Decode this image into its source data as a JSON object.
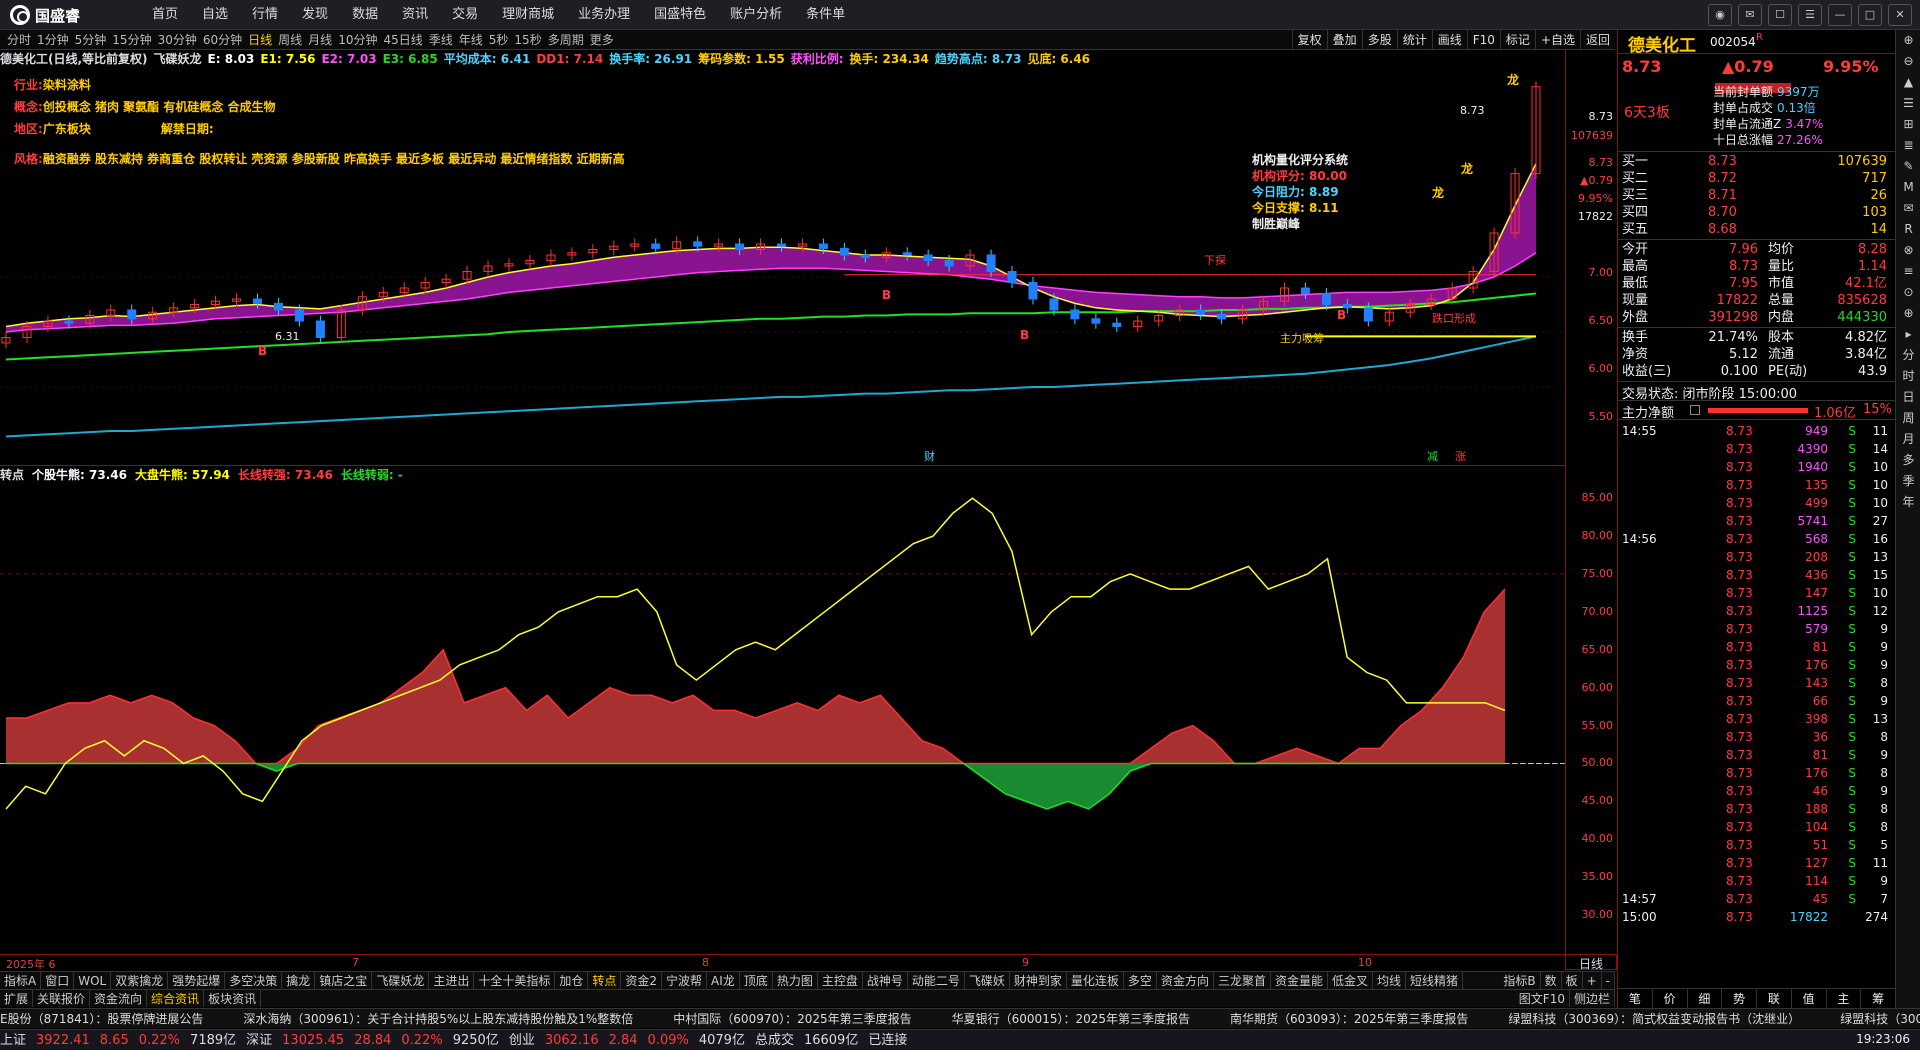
{
  "app": {
    "brand": "国盛睿",
    "menu": [
      "首页",
      "自选",
      "行情",
      "发现",
      "数据",
      "资讯",
      "交易",
      "理财商城",
      "业务办理",
      "国盛特色",
      "账户分析",
      "条件单"
    ]
  },
  "periods": [
    "分时",
    "1分钟",
    "5分钟",
    "15分钟",
    "30分钟",
    "60分钟",
    "日线",
    "周线",
    "月线",
    "10分钟",
    "45日线",
    "季线",
    "年线",
    "5秒",
    "15秒",
    "多周期",
    "更多"
  ],
  "selected_period": "日线",
  "tools": [
    "复权",
    "叠加",
    "多股",
    "统计",
    "画线",
    "F10",
    "标记",
    "+自选",
    "返回"
  ],
  "info_line": [
    {
      "t": "德美化工(日线,等比前复权)",
      "c": "#ddd"
    },
    {
      "t": "飞碟妖龙",
      "c": "#ddd"
    },
    {
      "t": "E: 8.03",
      "c": "#fff"
    },
    {
      "t": "E1: 7.56",
      "c": "#ffff00"
    },
    {
      "t": "E2: 7.03",
      "c": "#ff50ff"
    },
    {
      "t": "E3: 6.85",
      "c": "#2bd52b"
    },
    {
      "t": "平均成本: 6.41",
      "c": "#4ad4ff"
    },
    {
      "t": "DD1: 7.14",
      "c": "#ff3c3c"
    },
    {
      "t": "换手率: 26.91",
      "c": "#4ad4ff"
    },
    {
      "t": "筹码参数: 1.55",
      "c": "#ffcc00"
    },
    {
      "t": "获利比例:",
      "c": "#ff50ff"
    },
    {
      "t": "换手: 234.34",
      "c": "#ffcc00"
    },
    {
      "t": "趋势高点: 8.73",
      "c": "#4ad4ff"
    },
    {
      "t": "见底: 6.46",
      "c": "#ffcc00"
    }
  ],
  "overlay": {
    "industry_label": "行业:",
    "industry": "染料涂料",
    "concept_label": "概念:",
    "concept": "创投概念 猪肉 聚氨酯 有机硅概念 合成生物",
    "region_label": "地区:",
    "region": "广东板块",
    "unlock_label": "解禁日期:",
    "style_label": "风格:",
    "style": "融资融券 股东减持 券商重仓 股权转让 壳资源 参股新股 昨高换手 最近多板 最近异动 最近情绪指数 近期新高",
    "quant_title": "机构量化评分系统",
    "quant_rows": [
      "机构评分: 80.00",
      "今日阻力: 8.89",
      "今日支撑: 8.11",
      "制胜巅峰"
    ],
    "chart_labels": [
      "龙",
      "龙",
      "龙",
      "下探",
      "主力吸筹",
      "跌口形成",
      "B",
      "B",
      "B",
      "B",
      "6.31",
      "8.73",
      "财",
      "减",
      "涨"
    ]
  },
  "right_axis_top": {
    "labels": [
      "8.73",
      "107639",
      "8.73",
      "▲0.79",
      "9.95%",
      "17822",
      "7.00",
      "6.50",
      "6.00",
      "5.50"
    ]
  },
  "lower_header": [
    {
      "t": "转点",
      "c": "#ddd"
    },
    {
      "t": "个股牛熊: 73.46",
      "c": "#fff"
    },
    {
      "t": "大盘牛熊: 57.94",
      "c": "#ffff00"
    },
    {
      "t": "长线转强: 73.46",
      "c": "#ff3c3c"
    },
    {
      "t": "长线转弱: -",
      "c": "#2bd52b"
    }
  ],
  "lower_axis": [
    "85.00",
    "80.00",
    "75.00",
    "70.00",
    "65.00",
    "60.00",
    "55.00",
    "50.00",
    "45.00",
    "40.00",
    "35.00",
    "30.00"
  ],
  "xaxis": [
    "2025年 6",
    "7",
    "8",
    "9",
    "10"
  ],
  "tabs1": [
    "指标A",
    "窗口",
    "WOL",
    "双紫擒龙",
    "强势起爆",
    "多空决策",
    "擒龙",
    "镇店之宝",
    "飞碟妖龙",
    "主进出",
    "十全十美指标",
    "加仓",
    "转点",
    "资金2",
    "宁波帮",
    "AI龙",
    "顶底",
    "热力图",
    "主控盘",
    "战神号",
    "动能二号",
    "飞碟妖",
    "财神到家",
    "量化连板",
    "多空",
    "资金方向",
    "三龙聚首",
    "资金量能",
    "低金叉",
    "均线",
    "短线精猪"
  ],
  "tabs1_sel": "转点",
  "tabs1_right": [
    "指标B",
    "数",
    "板",
    "+",
    "-"
  ],
  "tabs2": [
    "扩展",
    "关联报价",
    "资金流向",
    "综合资讯",
    "板块资讯"
  ],
  "tabs2_sel": "综合资讯",
  "tabs2_right": [
    "图文F10",
    "侧边栏"
  ],
  "ticker": [
    "E股份（871841）：股票停牌进展公告",
    "深水海纳（300961）：关于合计持股5%以上股东减持股份触及1%整数倍",
    "中村国际（600970）：2025年第三季度报告",
    "华夏银行（600015）：2025年第三季度报告",
    "南华期货（603093）：2025年第三季度报告",
    "绿盟科技（300369）：简式权益变动报告书（沈继业）",
    "绿盟科技（300369）"
  ],
  "status": [
    {
      "t": "上证",
      "c": "#ddd"
    },
    {
      "t": "3922.41",
      "c": "#ff3c3c"
    },
    {
      "t": "8.65",
      "c": "#ff3c3c"
    },
    {
      "t": "0.22%",
      "c": "#ff3c3c"
    },
    {
      "t": "7189亿",
      "c": "#ddd"
    },
    {
      "t": "深证",
      "c": "#ddd"
    },
    {
      "t": "13025.45",
      "c": "#ff3c3c"
    },
    {
      "t": "28.84",
      "c": "#ff3c3c"
    },
    {
      "t": "0.22%",
      "c": "#ff3c3c"
    },
    {
      "t": "9250亿",
      "c": "#ddd"
    },
    {
      "t": "创业",
      "c": "#ddd"
    },
    {
      "t": "3062.16",
      "c": "#ff3c3c"
    },
    {
      "t": "2.84",
      "c": "#ff3c3c"
    },
    {
      "t": "0.09%",
      "c": "#ff3c3c"
    },
    {
      "t": "4079亿",
      "c": "#ddd"
    },
    {
      "t": "总成交",
      "c": "#ddd"
    },
    {
      "t": "16609亿",
      "c": "#ddd"
    },
    {
      "t": "已连接",
      "c": "#ddd"
    }
  ],
  "clock": "19:23:06",
  "quote": {
    "name": "德美化工",
    "code": "002054",
    "tag": "R",
    "price": "8.73",
    "change": "▲0.79",
    "pct": "9.95%",
    "board": "6天3板",
    "seal": [
      [
        "当前封单额",
        "9397万"
      ],
      [
        "封单占成交",
        "0.13倍"
      ],
      [
        "封单占流通Z",
        "3.47%"
      ],
      [
        "十日总涨幅",
        "27.26%"
      ]
    ],
    "bids": [
      [
        "买一",
        "8.73",
        "107639"
      ],
      [
        "买二",
        "8.72",
        "717"
      ],
      [
        "买三",
        "8.71",
        "26"
      ],
      [
        "买四",
        "8.70",
        "103"
      ],
      [
        "买五",
        "8.68",
        "14"
      ]
    ],
    "stats": [
      [
        "今开",
        "7.96",
        "均价",
        "8.28"
      ],
      [
        "最高",
        "8.73",
        "量比",
        "1.14"
      ],
      [
        "最低",
        "7.95",
        "市值",
        "42.1亿"
      ],
      [
        "现量",
        "17822",
        "总量",
        "835628"
      ],
      [
        "外盘",
        "391298",
        "内盘",
        "444330"
      ]
    ],
    "stats2": [
      [
        "换手",
        "21.74%",
        "股本",
        "4.82亿"
      ],
      [
        "净资",
        "5.12",
        "流通",
        "3.84亿"
      ],
      [
        "收益(三)",
        "0.100",
        "PE(动)",
        "43.9"
      ]
    ],
    "trade_state": "交易状态: 闭市阶段 15:00:00",
    "main_net_label": "主力净额",
    "main_net": "1.06亿",
    "main_net_pct": "15%"
  },
  "ticks": [
    [
      "14:55",
      "8.73",
      "949",
      "S",
      "11"
    ],
    [
      "",
      "8.73",
      "4390",
      "S",
      "14"
    ],
    [
      "",
      "8.73",
      "1940",
      "S",
      "10"
    ],
    [
      "",
      "8.73",
      "135",
      "S",
      "10"
    ],
    [
      "",
      "8.73",
      "499",
      "S",
      "10"
    ],
    [
      "",
      "8.73",
      "5741",
      "S",
      "27"
    ],
    [
      "14:56",
      "8.73",
      "568",
      "S",
      "16"
    ],
    [
      "",
      "8.73",
      "208",
      "S",
      "13"
    ],
    [
      "",
      "8.73",
      "436",
      "S",
      "15"
    ],
    [
      "",
      "8.73",
      "147",
      "S",
      "10"
    ],
    [
      "",
      "8.73",
      "1125",
      "S",
      "12"
    ],
    [
      "",
      "8.73",
      "579",
      "S",
      "9"
    ],
    [
      "",
      "8.73",
      "81",
      "S",
      "9"
    ],
    [
      "",
      "8.73",
      "176",
      "S",
      "9"
    ],
    [
      "",
      "8.73",
      "143",
      "S",
      "8"
    ],
    [
      "",
      "8.73",
      "66",
      "S",
      "9"
    ],
    [
      "",
      "8.73",
      "398",
      "S",
      "13"
    ],
    [
      "",
      "8.73",
      "36",
      "S",
      "8"
    ],
    [
      "",
      "8.73",
      "81",
      "S",
      "9"
    ],
    [
      "",
      "8.73",
      "176",
      "S",
      "8"
    ],
    [
      "",
      "8.73",
      "46",
      "S",
      "9"
    ],
    [
      "",
      "8.73",
      "188",
      "S",
      "8"
    ],
    [
      "",
      "8.73",
      "104",
      "S",
      "8"
    ],
    [
      "",
      "8.73",
      "51",
      "S",
      "5"
    ],
    [
      "",
      "8.73",
      "127",
      "S",
      "11"
    ],
    [
      "",
      "8.73",
      "114",
      "S",
      "9"
    ],
    [
      "14:57",
      "8.73",
      "45",
      "S",
      "7"
    ],
    [
      "15:00",
      "8.73",
      "17822",
      "",
      "274"
    ]
  ],
  "rp_tabs": [
    "笔",
    "价",
    "细",
    "势",
    "联",
    "值",
    "主",
    "筹"
  ],
  "rside": [
    "⊕",
    "⊖",
    "▲",
    "☰",
    "⊞",
    "≣",
    "✎",
    "M",
    "✉",
    "R",
    "⊗",
    "≡",
    "⊙",
    "⊕",
    "▸",
    "分",
    "时",
    "日",
    "周",
    "月",
    "多",
    "季",
    "年"
  ],
  "colors": {
    "up": "#ff3c3c",
    "down": "#2bd52b",
    "accent": "#ffcc00",
    "frame": "#8a1010"
  },
  "chart_data": {
    "type": "candlestick",
    "main": {
      "ylim": [
        5.3,
        8.9
      ],
      "ma_yellow": [
        6.55,
        6.58,
        6.6,
        6.62,
        6.63,
        6.65,
        6.64,
        6.66,
        6.68,
        6.7,
        6.72,
        6.74,
        6.75,
        6.73,
        6.72,
        6.71,
        6.74,
        6.77,
        6.8,
        6.83,
        6.86,
        6.9,
        6.95,
        7.0,
        7.04,
        7.07,
        7.1,
        7.12,
        7.15,
        7.18,
        7.2,
        7.22,
        7.24,
        7.25,
        7.26,
        7.26,
        7.27,
        7.27,
        7.26,
        7.24,
        7.22,
        7.2,
        7.2,
        7.19,
        7.18,
        7.17,
        7.16,
        7.1,
        7.0,
        6.9,
        6.82,
        6.76,
        6.72,
        6.7,
        6.69,
        6.68,
        6.66,
        6.65,
        6.64,
        6.65,
        6.66,
        6.68,
        6.7,
        6.72,
        6.73,
        6.72,
        6.71,
        6.72,
        6.74,
        6.8,
        6.95,
        7.25,
        7.65,
        8.03
      ],
      "ma_magenta": [
        6.5,
        6.52,
        6.53,
        6.54,
        6.55,
        6.56,
        6.56,
        6.57,
        6.58,
        6.6,
        6.62,
        6.63,
        6.64,
        6.65,
        6.66,
        6.67,
        6.68,
        6.7,
        6.72,
        6.74,
        6.76,
        6.78,
        6.8,
        6.83,
        6.86,
        6.88,
        6.9,
        6.92,
        6.94,
        6.96,
        6.98,
        7.0,
        7.02,
        7.04,
        7.05,
        7.06,
        7.07,
        7.08,
        7.08,
        7.08,
        7.07,
        7.06,
        7.05,
        7.04,
        7.03,
        7.02,
        7.0,
        6.98,
        6.95,
        6.92,
        6.9,
        6.88,
        6.86,
        6.85,
        6.84,
        6.83,
        6.82,
        6.82,
        6.81,
        6.81,
        6.82,
        6.83,
        6.84,
        6.85,
        6.86,
        6.86,
        6.86,
        6.87,
        6.88,
        6.9,
        6.94,
        7.0,
        7.1,
        7.22
      ],
      "ma_green": [
        6.25,
        6.26,
        6.27,
        6.28,
        6.29,
        6.3,
        6.31,
        6.32,
        6.33,
        6.34,
        6.35,
        6.36,
        6.37,
        6.38,
        6.39,
        6.4,
        6.41,
        6.42,
        6.43,
        6.44,
        6.45,
        6.46,
        6.47,
        6.48,
        6.5,
        6.51,
        6.52,
        6.53,
        6.54,
        6.55,
        6.56,
        6.57,
        6.58,
        6.59,
        6.6,
        6.61,
        6.62,
        6.62,
        6.63,
        6.64,
        6.64,
        6.65,
        6.65,
        6.66,
        6.66,
        6.66,
        6.67,
        6.67,
        6.67,
        6.67,
        6.68,
        6.68,
        6.68,
        6.68,
        6.69,
        6.69,
        6.69,
        6.69,
        6.7,
        6.7,
        6.71,
        6.71,
        6.72,
        6.72,
        6.73,
        6.73,
        6.74,
        6.75,
        6.76,
        6.77,
        6.79,
        6.81,
        6.83,
        6.85
      ],
      "ma_cyan": [
        5.55,
        5.56,
        5.57,
        5.58,
        5.59,
        5.6,
        5.6,
        5.61,
        5.62,
        5.63,
        5.64,
        5.65,
        5.66,
        5.67,
        5.68,
        5.69,
        5.7,
        5.71,
        5.72,
        5.73,
        5.74,
        5.75,
        5.76,
        5.77,
        5.78,
        5.79,
        5.8,
        5.81,
        5.82,
        5.83,
        5.84,
        5.85,
        5.86,
        5.87,
        5.88,
        5.89,
        5.9,
        5.91,
        5.91,
        5.92,
        5.93,
        5.94,
        5.94,
        5.95,
        5.96,
        5.97,
        5.97,
        5.98,
        5.99,
        6.0,
        6.0,
        6.01,
        6.02,
        6.03,
        6.04,
        6.05,
        6.06,
        6.07,
        6.08,
        6.09,
        6.1,
        6.11,
        6.12,
        6.14,
        6.16,
        6.18,
        6.2,
        6.23,
        6.26,
        6.3,
        6.34,
        6.38,
        6.42,
        6.46
      ],
      "closes": [
        6.45,
        6.55,
        6.6,
        6.58,
        6.65,
        6.7,
        6.62,
        6.68,
        6.72,
        6.75,
        6.78,
        6.8,
        6.76,
        6.7,
        6.6,
        6.45,
        6.7,
        6.82,
        6.86,
        6.9,
        6.95,
        6.98,
        7.05,
        7.1,
        7.12,
        7.15,
        7.2,
        7.22,
        7.25,
        7.28,
        7.3,
        7.26,
        7.32,
        7.28,
        7.3,
        7.25,
        7.3,
        7.28,
        7.3,
        7.26,
        7.2,
        7.18,
        7.22,
        7.2,
        7.15,
        7.1,
        7.2,
        7.05,
        6.95,
        6.8,
        6.7,
        6.62,
        6.58,
        6.55,
        6.6,
        6.65,
        6.7,
        6.66,
        6.62,
        6.7,
        6.78,
        6.9,
        6.85,
        6.75,
        6.72,
        6.6,
        6.68,
        6.75,
        6.8,
        6.9,
        7.05,
        7.4,
        7.94,
        8.73
      ]
    },
    "lower": {
      "ylim": [
        25,
        87
      ],
      "yellow": [
        44,
        47,
        46,
        50,
        52,
        53,
        51,
        53,
        52,
        50,
        51,
        49,
        46,
        45,
        49,
        53,
        55,
        56,
        57,
        58,
        59,
        60,
        61,
        63,
        64,
        65,
        67,
        68,
        70,
        71,
        72,
        72,
        73,
        70,
        63,
        61,
        63,
        65,
        66,
        65,
        67,
        69,
        71,
        73,
        75,
        77,
        79,
        80,
        83,
        85,
        83,
        78,
        67,
        70,
        72,
        72,
        74,
        75,
        74,
        73,
        73,
        74,
        75,
        76,
        73,
        74,
        75,
        77,
        64,
        62,
        61,
        58,
        58,
        58,
        58,
        58,
        57
      ],
      "red": [
        56,
        56,
        57,
        58,
        58,
        59,
        58,
        59,
        58,
        56,
        55,
        53,
        50,
        49,
        52,
        55,
        56,
        57,
        58,
        60,
        62,
        65,
        58,
        59,
        60,
        57,
        59,
        56,
        58,
        60,
        59,
        59,
        58,
        59,
        57,
        57,
        56,
        57,
        58,
        57,
        59,
        58,
        59,
        56,
        53,
        52,
        50,
        48,
        46,
        45,
        44,
        45,
        44,
        46,
        49,
        52,
        54,
        55,
        53,
        50,
        50,
        51,
        52,
        51,
        50,
        52,
        52,
        55,
        57,
        60,
        64,
        70,
        73
      ]
    }
  }
}
